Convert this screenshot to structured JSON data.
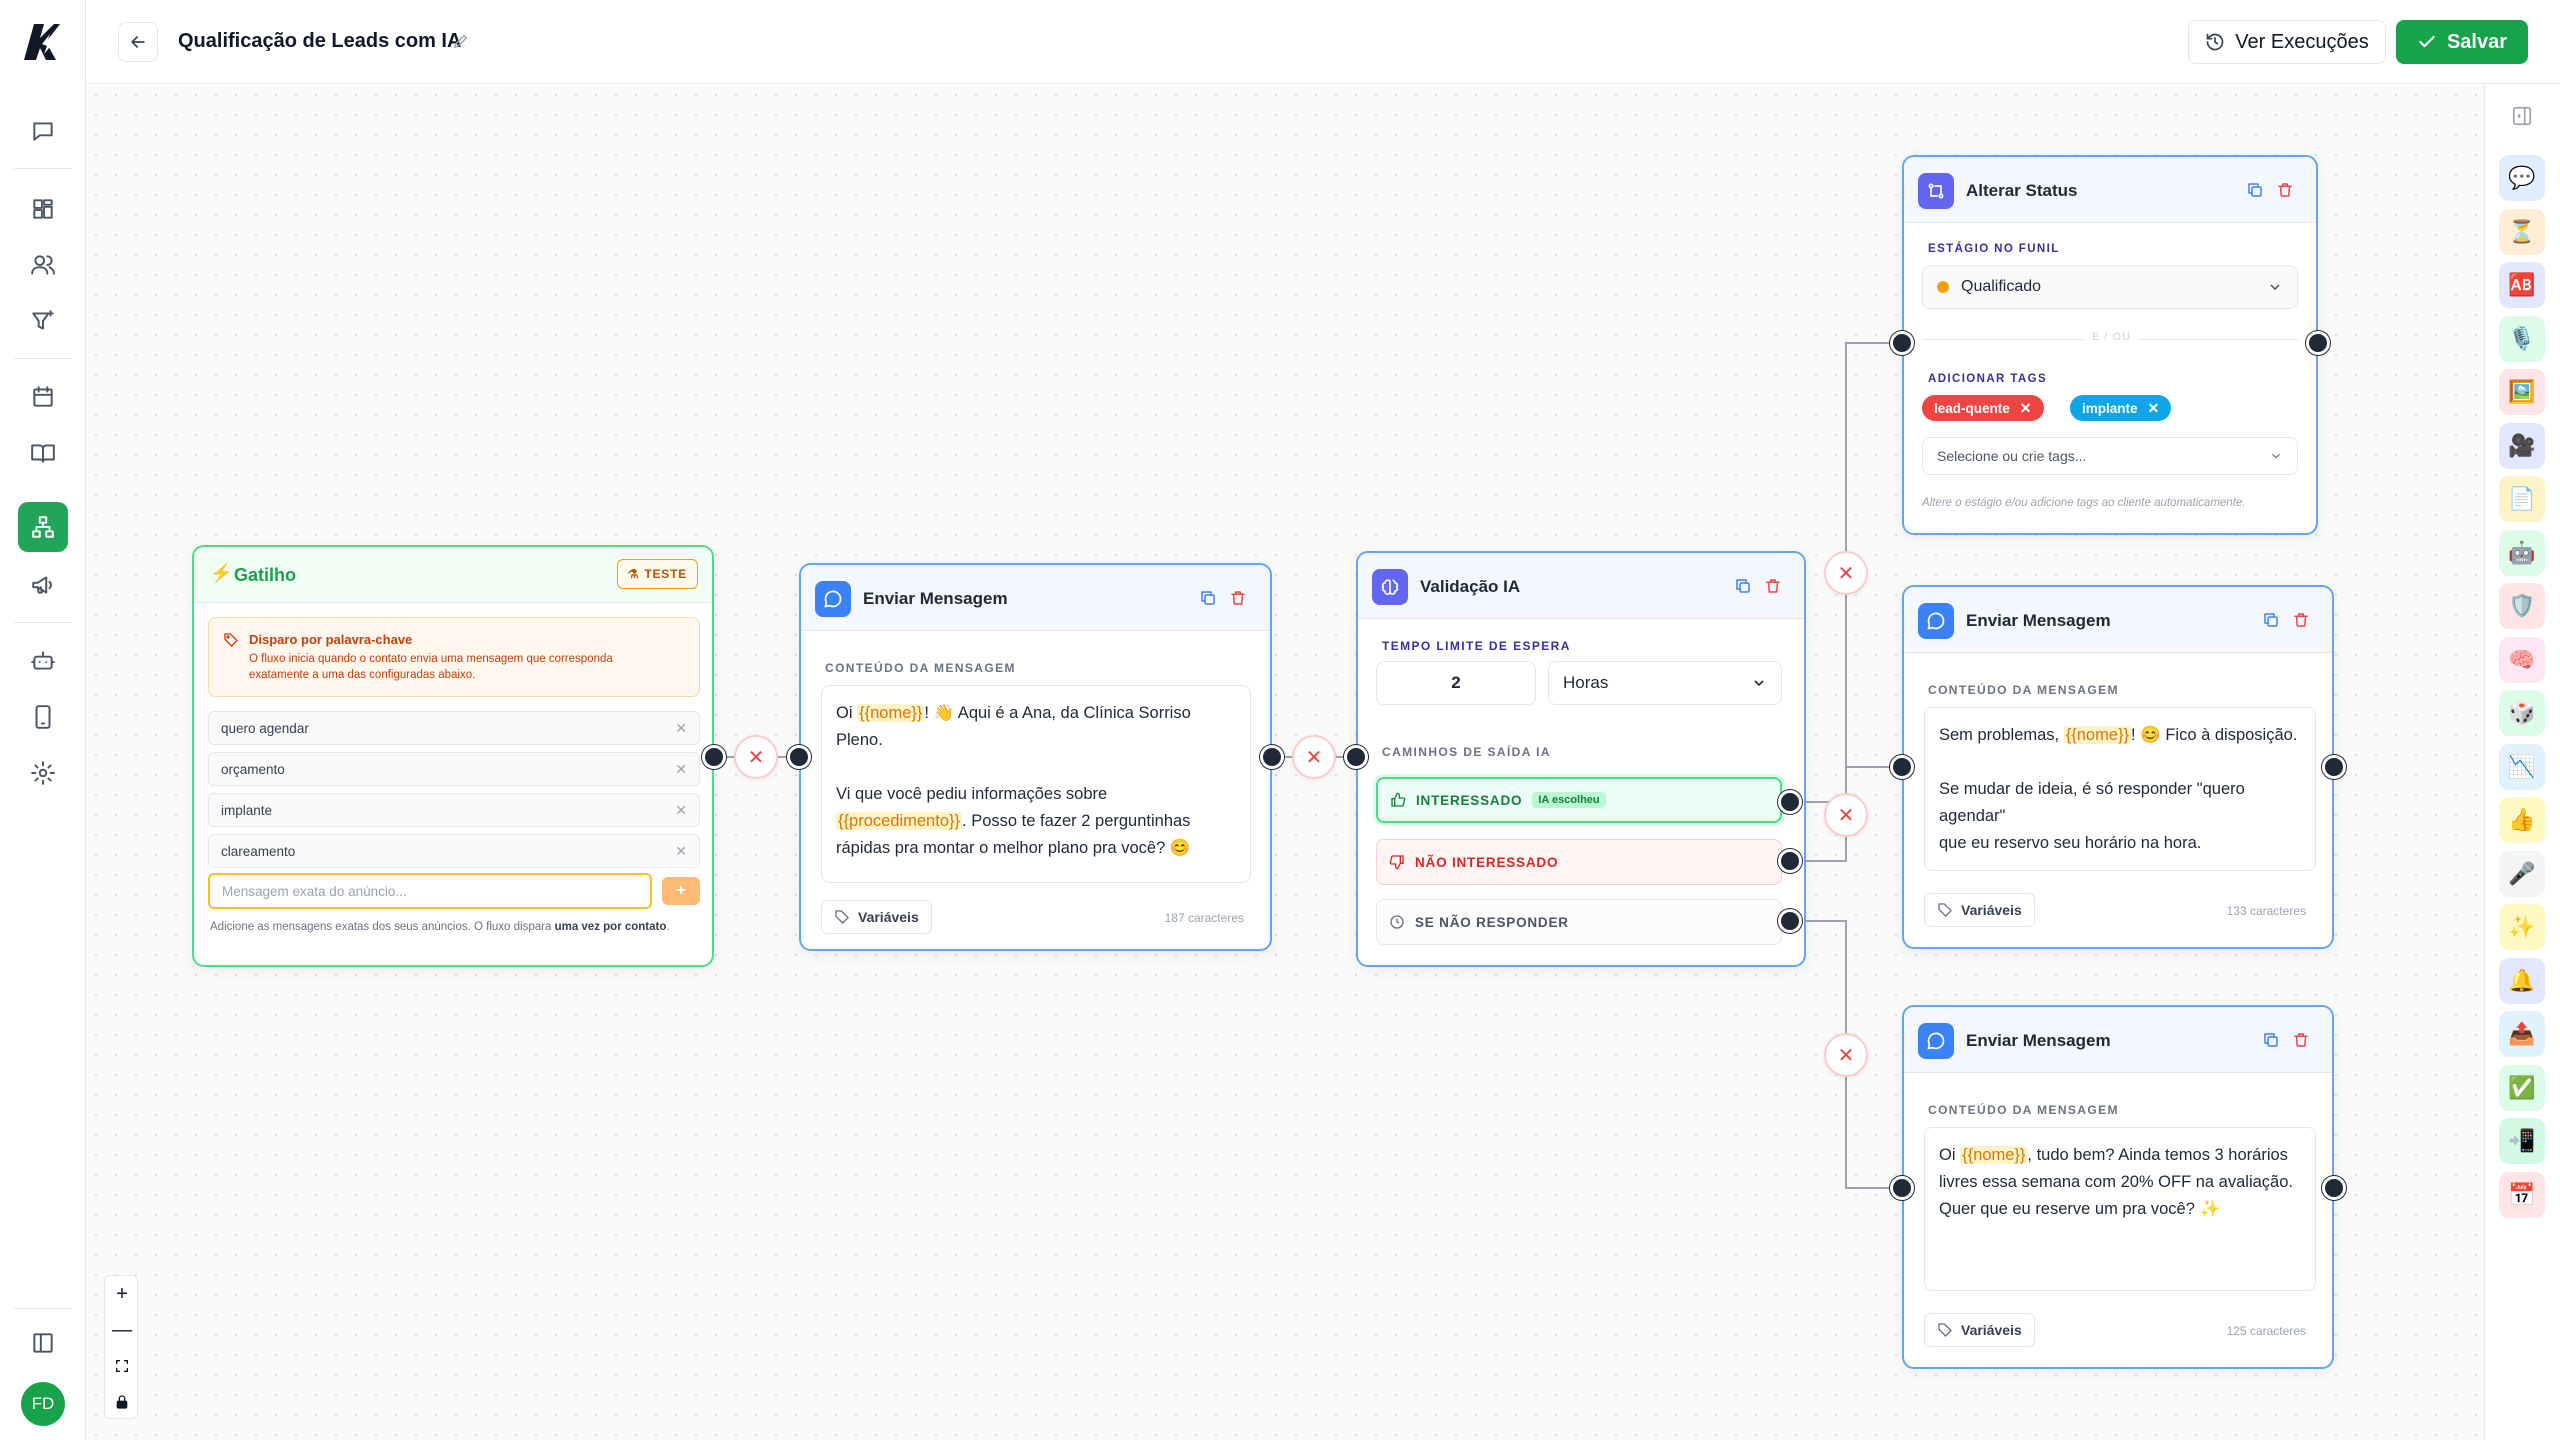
{
  "header": {
    "title": "Qualificação de Leads com IA",
    "exec_label": "Ver Execuções",
    "save_label": "Salvar"
  },
  "user": {
    "initials": "FD"
  },
  "nodes": {
    "trigger": {
      "title": "Gatilho",
      "badge": "TESTE",
      "kw_title": "Disparo por palavra-chave",
      "kw_desc": "O fluxo inicia quando o contato envia uma mensagem que corresponda exatamente a uma das configuradas abaixo.",
      "keywords": [
        "quero agendar",
        "orçamento",
        "implante",
        "clareamento"
      ],
      "input_placeholder": "Mensagem exata do anúncio...",
      "add_label": "+",
      "help_prefix": "Adicione as mensagens exatas dos seus anúncios. O fluxo dispara ",
      "help_bold": "uma vez por contato",
      "help_suffix": "."
    },
    "msg1": {
      "title": "Enviar Mensagem",
      "section": "CONTEÚDO DA MENSAGEM",
      "l1a": "Oi ",
      "l1v": "{{nome}}",
      "l1b": "! 👋  Aqui é a Ana, da Clínica Sorriso",
      "l2": "Pleno.",
      "l3": "Vi que você pediu informações sobre",
      "l4v": "{{procedimento}}",
      "l4b": ". Posso te fazer 2 perguntinhas",
      "l5": "rápidas pra montar o melhor plano pra você? 😊",
      "vars_label": "Variáveis",
      "chars": "187 caracteres"
    },
    "ai": {
      "title": "Validação IA",
      "wait_label": "TEMPO LIMITE DE ESPERA",
      "wait_value": "2",
      "wait_unit": "Horas",
      "paths_label": "CAMINHOS DE SAÍDA IA",
      "path_yes": "INTERESSADO",
      "path_yes_badge": "IA escolheu",
      "path_no": "NÃO INTERESSADO",
      "path_wait": "SE NÃO RESPONDER"
    },
    "status": {
      "title": "Alterar Status",
      "stage_label": "ESTÁGIO NO FUNIL",
      "stage_value": "Qualificado",
      "or": "E / OU",
      "tags_label": "ADICIONAR TAGS",
      "tags": [
        "lead-quente",
        "implante"
      ],
      "tags_x": "✕",
      "tags_placeholder": "Selecione ou crie tags...",
      "help": "Altere o estágio e/ou adicione tags ao cliente automaticamente."
    },
    "msg2": {
      "title": "Enviar Mensagem",
      "section": "CONTEÚDO DA MENSAGEM",
      "l1a": "Sem problemas, ",
      "l1v": "{{nome}}",
      "l1b": "! 😊  Fico à disposição.",
      "l2": "Se mudar de ideia, é só responder \"quero agendar\"",
      "l3": "que eu reservo seu horário na hora.",
      "vars_label": "Variáveis",
      "chars": "133 caracteres"
    },
    "msg3": {
      "title": "Enviar Mensagem",
      "section": "CONTEÚDO DA MENSAGEM",
      "l1a": "Oi ",
      "l1v": "{{nome}}",
      "l1b": ", tudo bem? Ainda temos 3 horários",
      "l2": "livres essa semana com 20% OFF na avaliação.",
      "l3": "Quer que eu reserve um pra você? ✨",
      "vars_label": "Variáveis",
      "chars": "125 caracteres"
    }
  },
  "zoom": {
    "in": "+",
    "out": "—"
  },
  "palette_icons": [
    "💬",
    "⏳",
    "🆎",
    "🎙️",
    "🖼️",
    "🎥",
    "📄",
    "🤖",
    "🛡️",
    "🧠",
    "🎲",
    "📉",
    "👍",
    "🎤",
    "✨",
    "🔔",
    "📤",
    "✅",
    "📲",
    "📅"
  ],
  "colors": {
    "accent": "#16a34a",
    "node_border": "#60a5fa",
    "tag_red": "#ef4444",
    "tag_blue": "#0ea5e9"
  }
}
